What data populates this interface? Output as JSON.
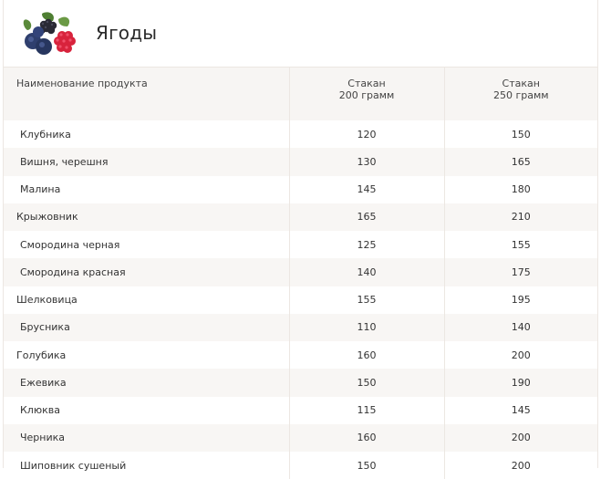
{
  "header": {
    "title": "Ягоды",
    "icon": "berries-icon"
  },
  "table": {
    "columns": [
      {
        "lines": [
          "Наименование продукта"
        ]
      },
      {
        "lines": [
          "Стакан",
          "200 грамм"
        ]
      },
      {
        "lines": [
          "Стакан",
          "250 грамм"
        ]
      }
    ],
    "rows": [
      {
        "name": "Клубника",
        "g200": "120",
        "g250": "150"
      },
      {
        "name": "Вишня, черешня",
        "g200": "130",
        "g250": "165"
      },
      {
        "name": "Малина",
        "g200": "145",
        "g250": "180"
      },
      {
        "name": "Крыжовник",
        "g200": "165",
        "g250": "210"
      },
      {
        "name": "Смородина черная",
        "g200": "125",
        "g250": "155"
      },
      {
        "name": "Смородина красная",
        "g200": "140",
        "g250": "175"
      },
      {
        "name": "Шелковица",
        "g200": "155",
        "g250": "195"
      },
      {
        "name": "Брусника",
        "g200": "110",
        "g250": "140"
      },
      {
        "name": "Голубика",
        "g200": "160",
        "g250": "200"
      },
      {
        "name": "Ежевика",
        "g200": "150",
        "g250": "190"
      },
      {
        "name": "Клюква",
        "g200": "115",
        "g250": "145"
      },
      {
        "name": "Черника",
        "g200": "160",
        "g250": "200"
      },
      {
        "name": "Шиповник сушеный",
        "g200": "150",
        "g250": "200"
      }
    ]
  },
  "colors": {
    "header_row_bg": "#f7f5f3",
    "stripe_bg": "#f8f6f4",
    "border": "#ece7e2",
    "text": "#333333"
  }
}
